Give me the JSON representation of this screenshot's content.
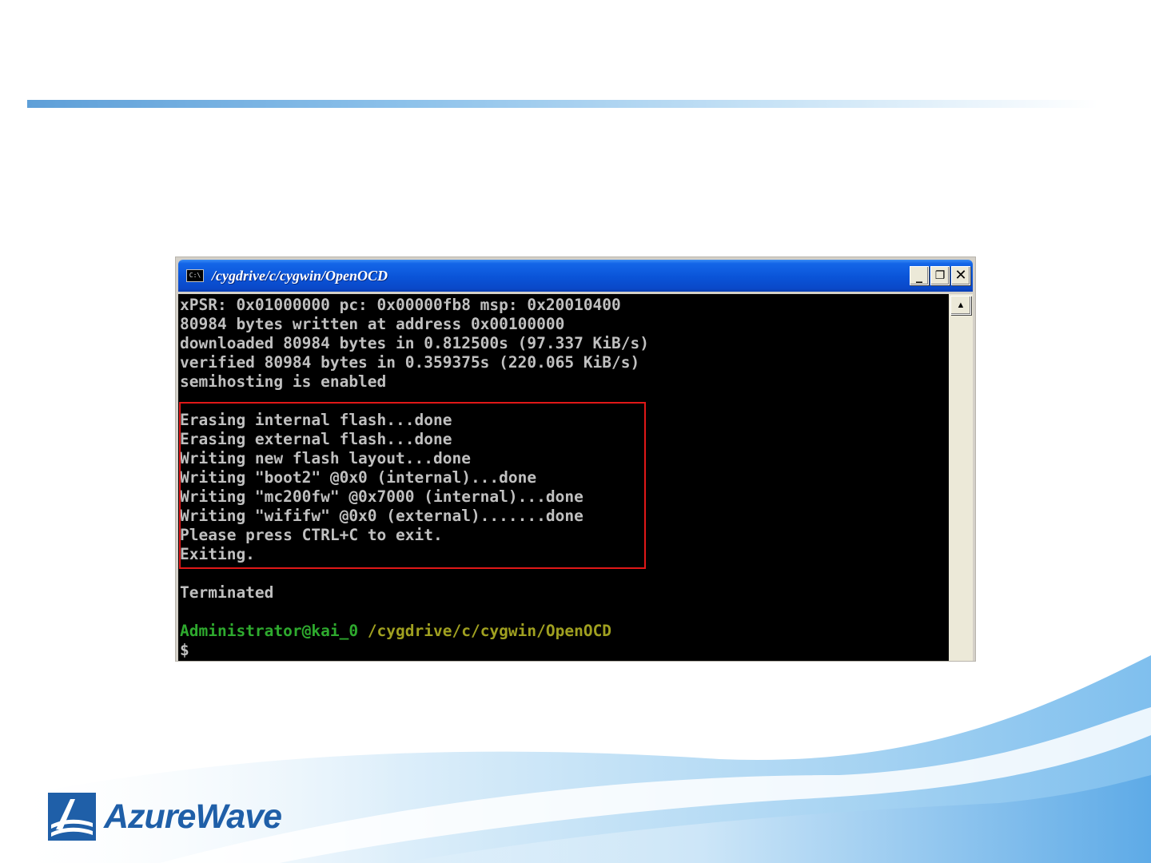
{
  "window": {
    "title": "/cygdrive/c/cygwin/OpenOCD",
    "icon_label": "C:\\",
    "minimize_label": "_",
    "restore_label": "❐",
    "close_label": "✕"
  },
  "terminal": {
    "lines": [
      "xPSR: 0x01000000 pc: 0x00000fb8 msp: 0x20010400",
      "80984 bytes written at address 0x00100000",
      "downloaded 80984 bytes in 0.812500s (97.337 KiB/s)",
      "verified 80984 bytes in 0.359375s (220.065 KiB/s)",
      "semihosting is enabled",
      "",
      "Erasing internal flash...done",
      "Erasing external flash...done",
      "Writing new flash layout...done",
      "Writing \"boot2\" @0x0 (internal)...done",
      "Writing \"mc200fw\" @0x7000 (internal)...done",
      "Writing \"wififw\" @0x0 (external).......done",
      "Please press CTRL+C to exit.",
      "Exiting.",
      "",
      "Terminated",
      ""
    ],
    "prompt_user": "Administrator@kai_0",
    "prompt_path": "/cygdrive/c/cygwin/OpenOCD",
    "prompt_symbol": "$"
  },
  "logo": {
    "text": "AzureWave"
  },
  "colors": {
    "titlebar": "#0a54d8",
    "terminal_bg": "#000000",
    "terminal_text": "#c0c0c0",
    "prompt_user": "#2eaa2e",
    "prompt_path": "#a0a020",
    "highlight": "#e01818",
    "brand": "#1f5fa8"
  }
}
